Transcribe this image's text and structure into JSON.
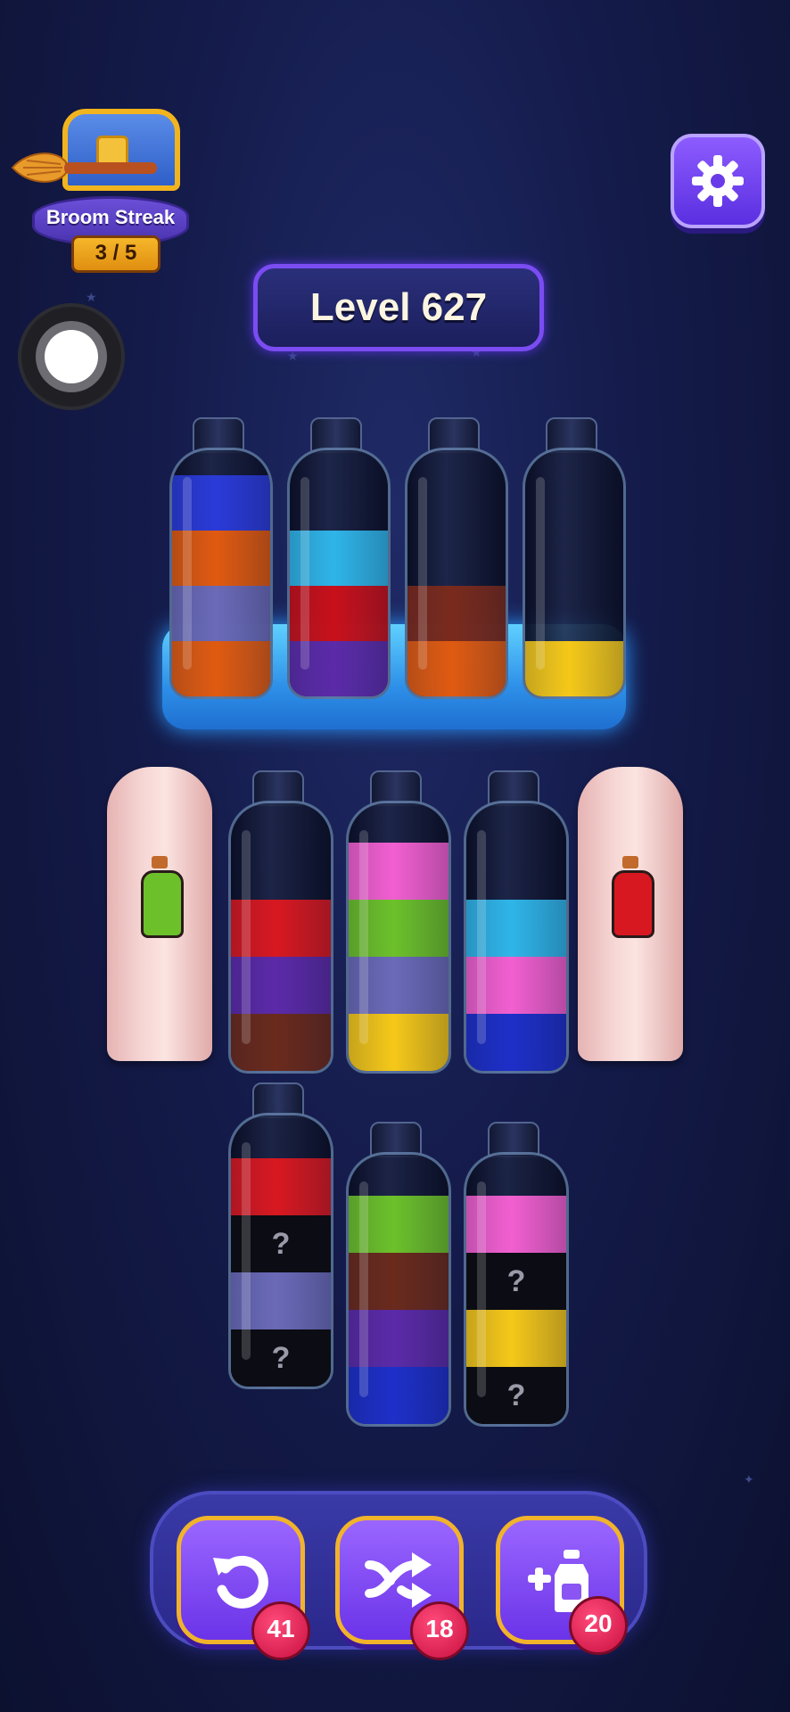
{
  "streak": {
    "label": "Broom Streak",
    "count": "3 / 5"
  },
  "level": {
    "label": "Level 627"
  },
  "icons": {
    "settings": "gear-icon",
    "undo": "undo-icon",
    "shuffle": "shuffle-icon",
    "add_bottle": "add-bottle-icon",
    "record": "record-icon"
  },
  "frozen_bottles": [
    {
      "layers": [
        "#2a3ad8",
        "#e05a10",
        "#6a6ab8",
        "#e05a10"
      ]
    },
    {
      "layers": [
        "#2fb5e8",
        "#c8101a",
        "#5b2aa8"
      ]
    },
    {
      "layers": [
        "#7a2a1c",
        "#e05a10"
      ]
    },
    {
      "layers": [
        "#f5c818"
      ]
    }
  ],
  "middle_row": [
    {
      "covered": true,
      "hint_color": "#6cc12a"
    },
    {
      "layers": [
        "#d81820",
        "#5b2aa8",
        "#6a2a1c"
      ]
    },
    {
      "layers": [
        "#f25fd0",
        "#6cc12a",
        "#6a6ab8",
        "#f5c818"
      ]
    },
    {
      "layers": [
        "#2fb5e8",
        "#f25fd0",
        "#1d2fc8"
      ]
    },
    {
      "covered": true,
      "hint_color": "#d81820"
    }
  ],
  "bottom_row": [
    {
      "layers": [
        "#d81820",
        "?",
        "#6a6ab8",
        "?"
      ]
    },
    {
      "layers": [
        "#6cc12a",
        "#6a2a1c",
        "#5b2aa8",
        "#1d2fc8"
      ]
    },
    {
      "layers": [
        "#f25fd0",
        "?",
        "#f5c818",
        "?"
      ]
    }
  ],
  "tools": [
    {
      "name": "undo",
      "count": "41"
    },
    {
      "name": "shuffle",
      "count": "18"
    },
    {
      "name": "add-bottle",
      "count": "20"
    }
  ]
}
